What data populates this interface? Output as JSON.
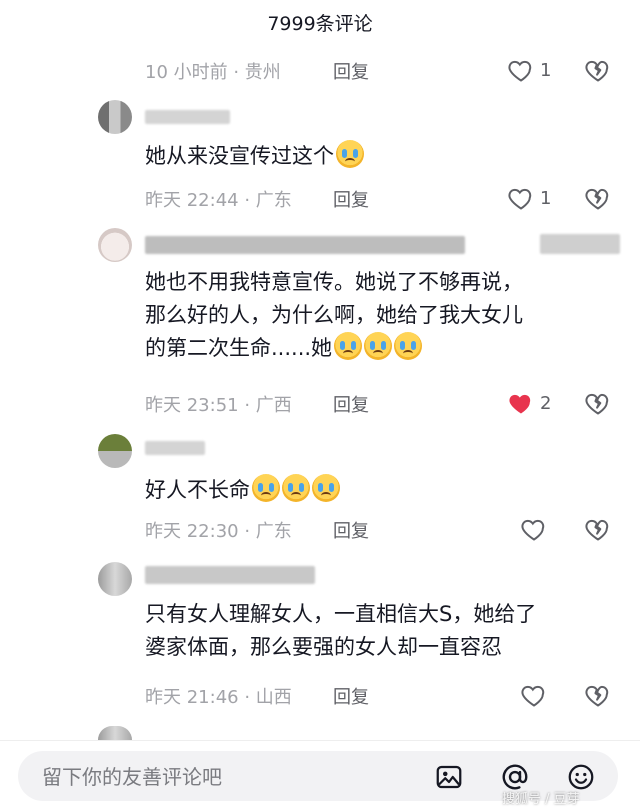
{
  "header": {
    "title": "7999条评论"
  },
  "reply_label": "回复",
  "comments": [
    {
      "meta": "10 小时前 · 贵州",
      "likes": "1",
      "liked": false
    },
    {
      "text": "她从来没宣传过这个",
      "meta": "昨天 22:44 · 广东",
      "likes": "1",
      "liked": false
    },
    {
      "lines": [
        "她也不用我特意宣传。她说了不够再说，",
        "那么好的人，为什么啊，她给了我大女儿",
        "的第二次生命......她"
      ],
      "meta": "昨天 23:51 · 广西",
      "likes": "2",
      "liked": true
    },
    {
      "text": "好人不长命",
      "meta": "昨天 22:30 · 广东",
      "likes": "",
      "liked": false
    },
    {
      "lines": [
        "只有女人理解女人，一直相信大S，她给了",
        "婆家体面，那么要强的女人却一直容忍"
      ],
      "meta": "昨天 21:46 · 山西",
      "likes": "",
      "liked": false
    }
  ],
  "input": {
    "placeholder": "留下你的友善评论吧"
  },
  "icons": {
    "like": "heart-outline-icon",
    "liked": "heart-filled-icon",
    "dislike": "broken-heart-icon",
    "image": "image-icon",
    "mention": "at-icon",
    "emoji": "smiley-icon"
  },
  "colors": {
    "liked_heart": "#e8344e",
    "meta_gray": "#a2a3a8"
  },
  "watermark": "搜狐号 / 豆芽"
}
